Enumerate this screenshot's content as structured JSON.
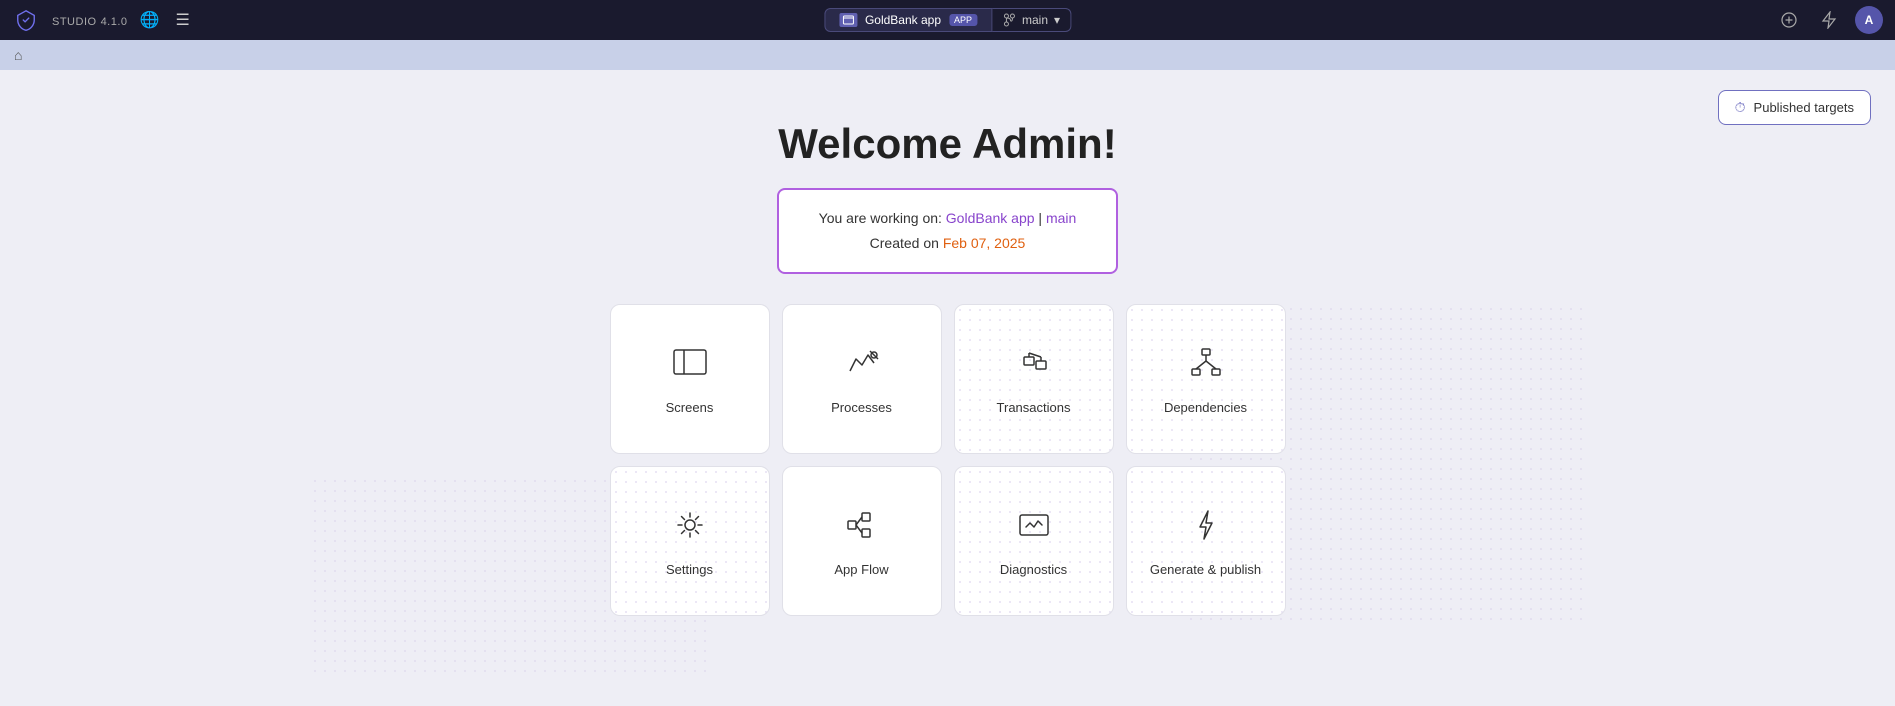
{
  "navbar": {
    "logo_alt": "Voltmind logo",
    "brand": "STUDIO",
    "version": "4.1.0",
    "app_name": "GoldBank app",
    "app_type": "APP",
    "branch": "main",
    "avatar_initials": "A"
  },
  "sub_navbar": {
    "home_icon": "⌂"
  },
  "published_targets": {
    "label": "Published targets"
  },
  "welcome": {
    "title": "Welcome Admin!",
    "working_on_prefix": "You are working on: ",
    "app_link": "GoldBank app",
    "separator": " | ",
    "branch_link": "main",
    "created_prefix": "Created on ",
    "created_date": "Feb 07, 2025"
  },
  "cards": [
    {
      "id": "screens",
      "label": "Screens",
      "icon": "screens"
    },
    {
      "id": "processes",
      "label": "Processes",
      "icon": "processes"
    },
    {
      "id": "transactions",
      "label": "Transactions",
      "icon": "transactions"
    },
    {
      "id": "dependencies",
      "label": "Dependencies",
      "icon": "dependencies"
    },
    {
      "id": "settings",
      "label": "Settings",
      "icon": "settings"
    },
    {
      "id": "app-flow",
      "label": "App Flow",
      "icon": "appflow"
    },
    {
      "id": "diagnostics",
      "label": "Diagnostics",
      "icon": "diagnostics"
    },
    {
      "id": "generate-publish",
      "label": "Generate & publish",
      "icon": "generate"
    }
  ]
}
